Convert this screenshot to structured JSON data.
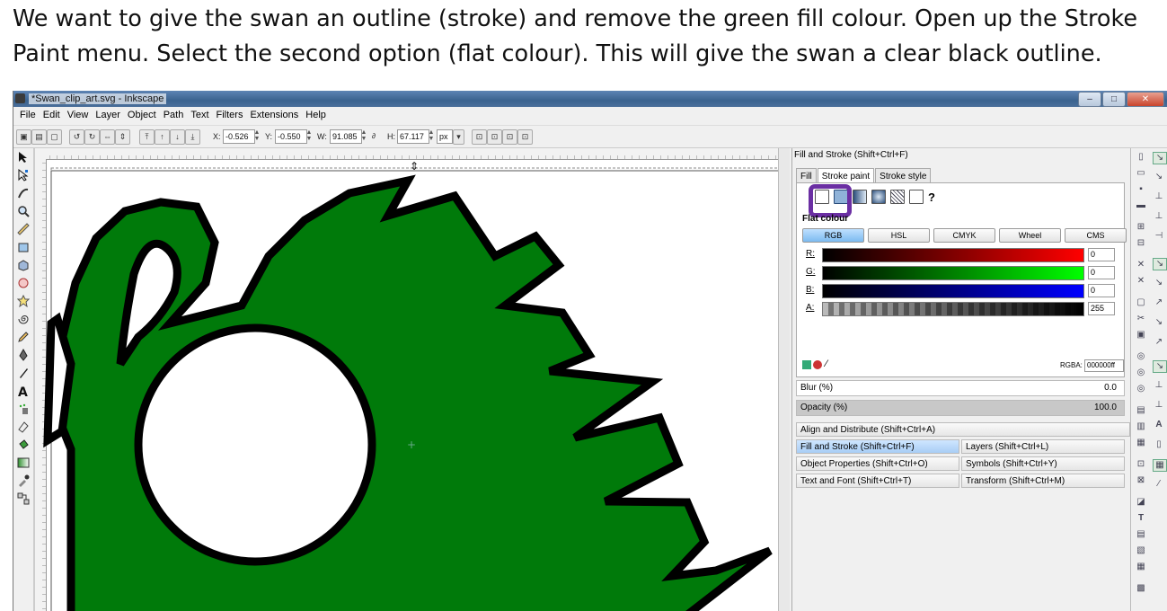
{
  "instructions": "We want to give the swan an outline (stroke) and remove the green fill colour. Open up the Stroke Paint menu. Select the second option (flat colour). This will give the swan a clear black outline.",
  "window": {
    "title": "*Swan_clip_art.svg - Inkscape",
    "buttons": {
      "minimize": "–",
      "maximize": "□",
      "close": "✕"
    }
  },
  "menu": [
    "File",
    "Edit",
    "View",
    "Layer",
    "Object",
    "Path",
    "Text",
    "Filters",
    "Extensions",
    "Help"
  ],
  "toolbar": {
    "x_label": "X:",
    "x_value": "-0.526",
    "y_label": "Y:",
    "y_value": "-0.550",
    "w_label": "W:",
    "w_value": "91.085",
    "h_label": "H:",
    "h_value": "67.117",
    "unit": "px"
  },
  "panel": {
    "title": "Fill and Stroke (Shift+Ctrl+F)",
    "tabs": [
      "Fill",
      "Stroke paint",
      "Stroke style"
    ],
    "help_glyph": "?",
    "flat_label": "Flat colour",
    "color_modes": [
      "RGB",
      "HSL",
      "CMYK",
      "Wheel",
      "CMS"
    ],
    "channels": [
      {
        "label": "R:",
        "value": "0"
      },
      {
        "label": "G:",
        "value": "0"
      },
      {
        "label": "B:",
        "value": "0"
      },
      {
        "label": "A:",
        "value": "255"
      }
    ],
    "rgba_label": "RGBA:",
    "rgba_value": "000000ff",
    "blur_label": "Blur (%)",
    "blur_value": "0.0",
    "opacity_label": "Opacity (%)",
    "opacity_value": "100.0",
    "docks": {
      "align": "Align and Distribute (Shift+Ctrl+A)",
      "fill_stroke": "Fill and Stroke (Shift+Ctrl+F)",
      "layers": "Layers (Shift+Ctrl+L)",
      "object_props": "Object Properties (Shift+Ctrl+O)",
      "symbols": "Symbols (Shift+Ctrl+Y)",
      "text_font": "Text and Font (Shift+Ctrl+T)",
      "transform": "Transform (Shift+Ctrl+M)"
    }
  },
  "colors": {
    "swan_fill": "#007a0a",
    "swan_stroke": "#000000",
    "highlight": "#6b2fa3"
  }
}
